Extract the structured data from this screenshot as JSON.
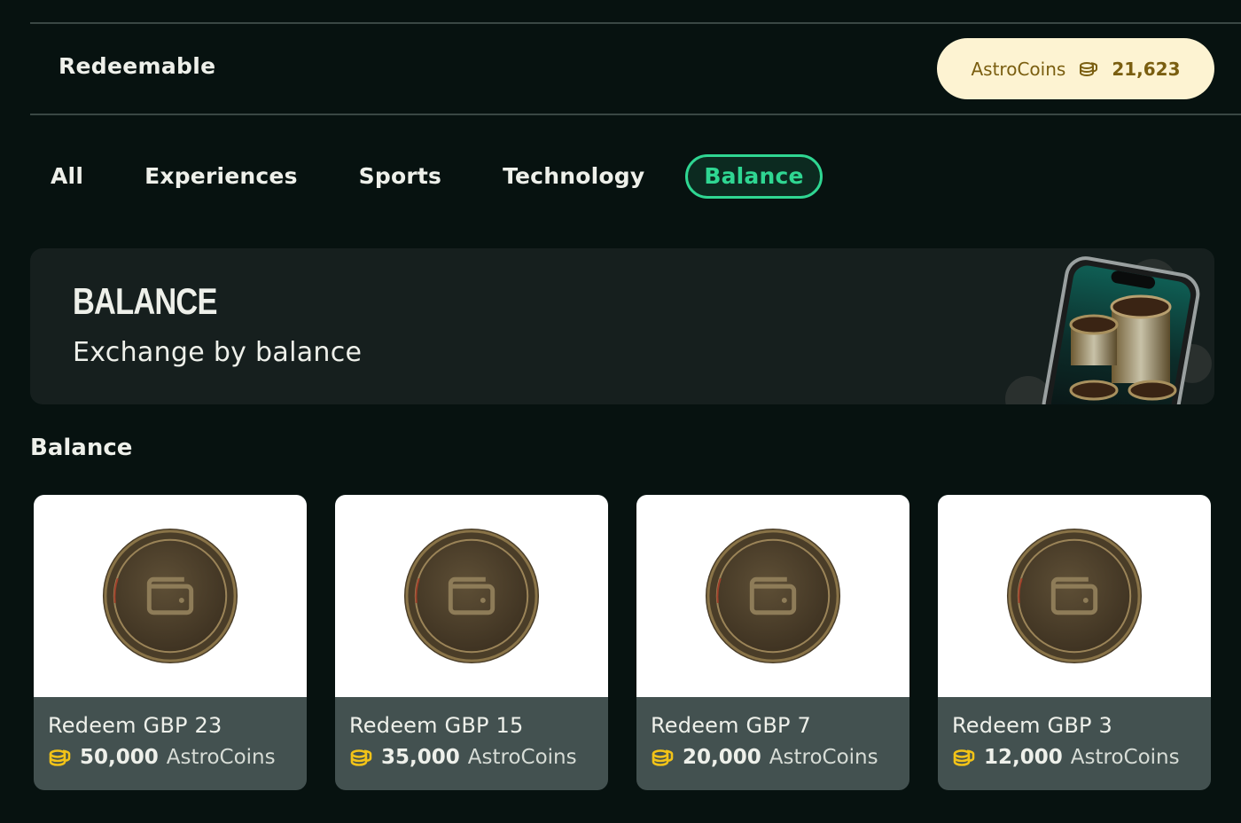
{
  "header": {
    "title": "Redeemable",
    "balance": {
      "label": "AstroCoins",
      "icon": "coin-stack-icon",
      "value": "21,623"
    }
  },
  "tabs": [
    {
      "label": "All",
      "active": false
    },
    {
      "label": "Experiences",
      "active": false
    },
    {
      "label": "Sports",
      "active": false
    },
    {
      "label": "Technology",
      "active": false
    },
    {
      "label": "Balance",
      "active": true
    }
  ],
  "banner": {
    "title": "BALANCE",
    "subtitle": "Exchange by balance",
    "image": "phone-with-coins-illustration"
  },
  "section": {
    "title": "Balance"
  },
  "cards": [
    {
      "name": "Redeem GBP 23",
      "price": "50,000",
      "unit": "AstroCoins",
      "image": "wallet-coin-image"
    },
    {
      "name": "Redeem GBP 15",
      "price": "35,000",
      "unit": "AstroCoins",
      "image": "wallet-coin-image"
    },
    {
      "name": "Redeem GBP 7",
      "price": "20,000",
      "unit": "AstroCoins",
      "image": "wallet-coin-image"
    },
    {
      "name": "Redeem GBP 3",
      "price": "12,000",
      "unit": "AstroCoins",
      "image": "wallet-coin-image"
    }
  ],
  "colors": {
    "background": "#071210",
    "accent": "#2fd692",
    "pill_bg": "#fdf3d2",
    "pill_text": "#7a5e10",
    "card_footer": "#435150",
    "coin_gold": "#f2c318"
  }
}
